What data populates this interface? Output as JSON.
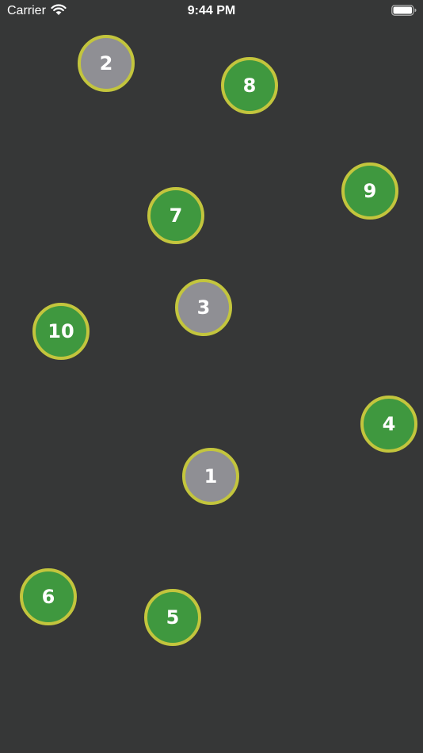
{
  "status_bar": {
    "carrier": "Carrier",
    "time": "9:44 PM",
    "wifi_icon": "wifi-icon",
    "battery_icon": "battery-icon"
  },
  "colors": {
    "background": "#363737",
    "ring": "#c3c53d",
    "green_fill": "#3f983f",
    "grey_fill": "#8f8f94",
    "label": "#ffffff"
  },
  "dots": {
    "d1": {
      "label": "1",
      "state": "grey"
    },
    "d2": {
      "label": "2",
      "state": "grey"
    },
    "d3": {
      "label": "3",
      "state": "grey"
    },
    "d4": {
      "label": "4",
      "state": "green"
    },
    "d5": {
      "label": "5",
      "state": "green"
    },
    "d6": {
      "label": "6",
      "state": "green"
    },
    "d7": {
      "label": "7",
      "state": "green"
    },
    "d8": {
      "label": "8",
      "state": "green"
    },
    "d9": {
      "label": "9",
      "state": "green"
    },
    "d10": {
      "label": "10",
      "state": "green"
    }
  }
}
